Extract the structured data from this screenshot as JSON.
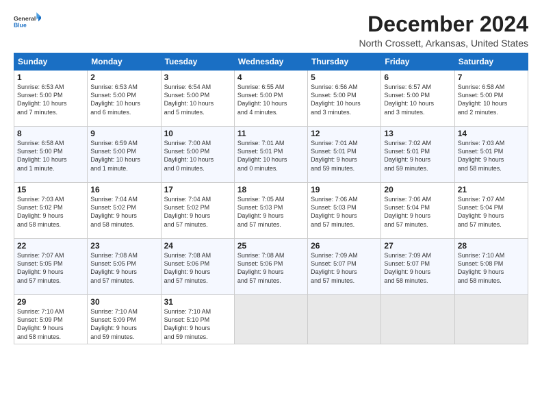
{
  "logo": {
    "general": "General",
    "blue": "Blue"
  },
  "title": "December 2024",
  "subtitle": "North Crossett, Arkansas, United States",
  "days_of_week": [
    "Sunday",
    "Monday",
    "Tuesday",
    "Wednesday",
    "Thursday",
    "Friday",
    "Saturday"
  ],
  "weeks": [
    [
      {
        "day": "1",
        "info": "Sunrise: 6:53 AM\nSunset: 5:00 PM\nDaylight: 10 hours\nand 7 minutes."
      },
      {
        "day": "2",
        "info": "Sunrise: 6:53 AM\nSunset: 5:00 PM\nDaylight: 10 hours\nand 6 minutes."
      },
      {
        "day": "3",
        "info": "Sunrise: 6:54 AM\nSunset: 5:00 PM\nDaylight: 10 hours\nand 5 minutes."
      },
      {
        "day": "4",
        "info": "Sunrise: 6:55 AM\nSunset: 5:00 PM\nDaylight: 10 hours\nand 4 minutes."
      },
      {
        "day": "5",
        "info": "Sunrise: 6:56 AM\nSunset: 5:00 PM\nDaylight: 10 hours\nand 3 minutes."
      },
      {
        "day": "6",
        "info": "Sunrise: 6:57 AM\nSunset: 5:00 PM\nDaylight: 10 hours\nand 3 minutes."
      },
      {
        "day": "7",
        "info": "Sunrise: 6:58 AM\nSunset: 5:00 PM\nDaylight: 10 hours\nand 2 minutes."
      }
    ],
    [
      {
        "day": "8",
        "info": "Sunrise: 6:58 AM\nSunset: 5:00 PM\nDaylight: 10 hours\nand 1 minute."
      },
      {
        "day": "9",
        "info": "Sunrise: 6:59 AM\nSunset: 5:00 PM\nDaylight: 10 hours\nand 1 minute."
      },
      {
        "day": "10",
        "info": "Sunrise: 7:00 AM\nSunset: 5:00 PM\nDaylight: 10 hours\nand 0 minutes."
      },
      {
        "day": "11",
        "info": "Sunrise: 7:01 AM\nSunset: 5:01 PM\nDaylight: 10 hours\nand 0 minutes."
      },
      {
        "day": "12",
        "info": "Sunrise: 7:01 AM\nSunset: 5:01 PM\nDaylight: 9 hours\nand 59 minutes."
      },
      {
        "day": "13",
        "info": "Sunrise: 7:02 AM\nSunset: 5:01 PM\nDaylight: 9 hours\nand 59 minutes."
      },
      {
        "day": "14",
        "info": "Sunrise: 7:03 AM\nSunset: 5:01 PM\nDaylight: 9 hours\nand 58 minutes."
      }
    ],
    [
      {
        "day": "15",
        "info": "Sunrise: 7:03 AM\nSunset: 5:02 PM\nDaylight: 9 hours\nand 58 minutes."
      },
      {
        "day": "16",
        "info": "Sunrise: 7:04 AM\nSunset: 5:02 PM\nDaylight: 9 hours\nand 58 minutes."
      },
      {
        "day": "17",
        "info": "Sunrise: 7:04 AM\nSunset: 5:02 PM\nDaylight: 9 hours\nand 57 minutes."
      },
      {
        "day": "18",
        "info": "Sunrise: 7:05 AM\nSunset: 5:03 PM\nDaylight: 9 hours\nand 57 minutes."
      },
      {
        "day": "19",
        "info": "Sunrise: 7:06 AM\nSunset: 5:03 PM\nDaylight: 9 hours\nand 57 minutes."
      },
      {
        "day": "20",
        "info": "Sunrise: 7:06 AM\nSunset: 5:04 PM\nDaylight: 9 hours\nand 57 minutes."
      },
      {
        "day": "21",
        "info": "Sunrise: 7:07 AM\nSunset: 5:04 PM\nDaylight: 9 hours\nand 57 minutes."
      }
    ],
    [
      {
        "day": "22",
        "info": "Sunrise: 7:07 AM\nSunset: 5:05 PM\nDaylight: 9 hours\nand 57 minutes."
      },
      {
        "day": "23",
        "info": "Sunrise: 7:08 AM\nSunset: 5:05 PM\nDaylight: 9 hours\nand 57 minutes."
      },
      {
        "day": "24",
        "info": "Sunrise: 7:08 AM\nSunset: 5:06 PM\nDaylight: 9 hours\nand 57 minutes."
      },
      {
        "day": "25",
        "info": "Sunrise: 7:08 AM\nSunset: 5:06 PM\nDaylight: 9 hours\nand 57 minutes."
      },
      {
        "day": "26",
        "info": "Sunrise: 7:09 AM\nSunset: 5:07 PM\nDaylight: 9 hours\nand 57 minutes."
      },
      {
        "day": "27",
        "info": "Sunrise: 7:09 AM\nSunset: 5:07 PM\nDaylight: 9 hours\nand 58 minutes."
      },
      {
        "day": "28",
        "info": "Sunrise: 7:10 AM\nSunset: 5:08 PM\nDaylight: 9 hours\nand 58 minutes."
      }
    ],
    [
      {
        "day": "29",
        "info": "Sunrise: 7:10 AM\nSunset: 5:09 PM\nDaylight: 9 hours\nand 58 minutes."
      },
      {
        "day": "30",
        "info": "Sunrise: 7:10 AM\nSunset: 5:09 PM\nDaylight: 9 hours\nand 59 minutes."
      },
      {
        "day": "31",
        "info": "Sunrise: 7:10 AM\nSunset: 5:10 PM\nDaylight: 9 hours\nand 59 minutes."
      },
      {
        "day": "",
        "info": ""
      },
      {
        "day": "",
        "info": ""
      },
      {
        "day": "",
        "info": ""
      },
      {
        "day": "",
        "info": ""
      }
    ]
  ]
}
